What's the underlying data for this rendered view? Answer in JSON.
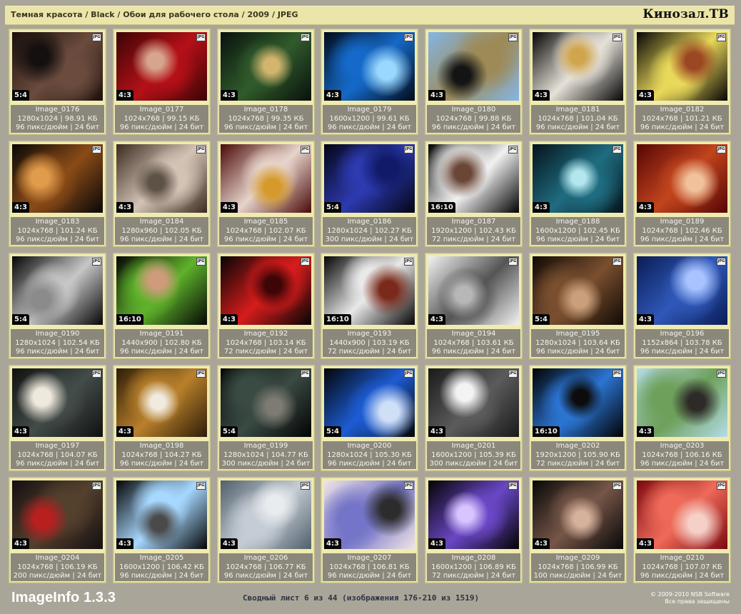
{
  "header": {
    "breadcrumb": "Темная красота / Black / Обои для рабочего стола / 2009 / JPEG",
    "brand": "Кинозал.ТВ"
  },
  "colors": {
    "background": "#a9a699",
    "card": "#f0ebb0",
    "info_panel": "#8b877a",
    "topbar": "#ebe5aa"
  },
  "thumbnails": [
    {
      "name": "Image_0176",
      "details": "1280x1024 | 98.91 КБ",
      "dpi": "96 пикс/дюйм | 24 бит",
      "ratio": "5:4",
      "colors": [
        "#1b0f0b",
        "#6b4b3d",
        "#151010"
      ],
      "icon": "jpg-file-icon"
    },
    {
      "name": "Image_0177",
      "details": "1024x768 | 99.15 КБ",
      "dpi": "96 пикс/дюйм | 24 бит",
      "ratio": "4:3",
      "colors": [
        "#3b0505",
        "#b51018",
        "#d6a58c"
      ],
      "icon": "jpg-file-icon"
    },
    {
      "name": "Image_0178",
      "details": "1024x768 | 99.35 КБ",
      "dpi": "96 пикс/дюйм | 24 бит",
      "ratio": "4:3",
      "colors": [
        "#08110c",
        "#315b2c",
        "#d3b56e"
      ],
      "icon": "jpg-file-icon"
    },
    {
      "name": "Image_0179",
      "details": "1600x1200 | 99.61 КБ",
      "dpi": "96 пикс/дюйм | 24 бит",
      "ratio": "4:3",
      "colors": [
        "#020b18",
        "#1569c8",
        "#9bd8ff"
      ],
      "icon": "jpg-file-icon"
    },
    {
      "name": "Image_0180",
      "details": "1024x768 | 99.88 КБ",
      "dpi": "96 пикс/дюйм | 24 бит",
      "ratio": "4:3",
      "colors": [
        "#84b6e7",
        "#9d8a57",
        "#141414"
      ],
      "icon": "jpg-file-icon"
    },
    {
      "name": "Image_0181",
      "details": "1024x768 | 101.04 КБ",
      "dpi": "96 пикс/дюйм | 24 бит",
      "ratio": "4:3",
      "colors": [
        "#050505",
        "#e6e1d8",
        "#d1a54d"
      ],
      "icon": "jpg-file-icon"
    },
    {
      "name": "Image_0182",
      "details": "1024x768 | 101.21 КБ",
      "dpi": "96 пикс/дюйм | 24 бит",
      "ratio": "4:3",
      "colors": [
        "#070505",
        "#e9d95a",
        "#9b4723"
      ],
      "icon": "jpg-file-icon"
    },
    {
      "name": "Image_0183",
      "details": "1024x768 | 101.24 КБ",
      "dpi": "96 пикс/дюйм | 24 бит",
      "ratio": "4:3",
      "colors": [
        "#080707",
        "#8a4b17",
        "#e09b4b"
      ],
      "icon": "jpg-file-icon"
    },
    {
      "name": "Image_0184",
      "details": "1280x960 | 102.05 КБ",
      "dpi": "96 пикс/дюйм | 24 бит",
      "ratio": "4:3",
      "colors": [
        "#3c2b20",
        "#d3c3b5",
        "#5e5146"
      ],
      "icon": "jpg-file-icon"
    },
    {
      "name": "Image_0185",
      "details": "1024x768 | 102.07 КБ",
      "dpi": "96 пикс/дюйм | 24 бит",
      "ratio": "4:3",
      "colors": [
        "#4a0a0a",
        "#e7d4ca",
        "#d59a2b"
      ],
      "icon": "jpg-file-icon"
    },
    {
      "name": "Image_0186",
      "details": "1280x1024 | 102.27 КБ",
      "dpi": "300 пикс/дюйм | 24 бит",
      "ratio": "5:4",
      "colors": [
        "#030514",
        "#2d3ab0",
        "#101a66"
      ],
      "icon": "jpg-file-icon"
    },
    {
      "name": "Image_0187",
      "details": "1920x1200 | 102.43 КБ",
      "dpi": "72 пикс/дюйм | 24 бит",
      "ratio": "16:10",
      "colors": [
        "#020202",
        "#f1f1f1",
        "#6a4636"
      ],
      "icon": "jpg-file-icon"
    },
    {
      "name": "Image_0188",
      "details": "1600x1200 | 102.45 КБ",
      "dpi": "96 пикс/дюйм | 24 бит",
      "ratio": "4:3",
      "colors": [
        "#05131b",
        "#1f6c80",
        "#b4e6ee"
      ],
      "icon": "jpg-file-icon"
    },
    {
      "name": "Image_0189",
      "details": "1024x768 | 102.46 КБ",
      "dpi": "96 пикс/дюйм | 24 бит",
      "ratio": "4:3",
      "colors": [
        "#560505",
        "#c1441d",
        "#f0c19a"
      ],
      "icon": "jpg-file-icon"
    },
    {
      "name": "Image_0190",
      "details": "1280x1024 | 102.54 КБ",
      "dpi": "96 пикс/дюйм | 24 бит",
      "ratio": "5:4",
      "colors": [
        "#050505",
        "#c7c7c7",
        "#8b8b8b"
      ],
      "icon": "jpg-file-icon"
    },
    {
      "name": "Image_0191",
      "details": "1440x900 | 102.80 КБ",
      "dpi": "96 пикс/дюйм | 24 бит",
      "ratio": "16:10",
      "colors": [
        "#050604",
        "#5fb22b",
        "#d09b7c"
      ],
      "icon": "jpg-file-icon"
    },
    {
      "name": "Image_0192",
      "details": "1024x768 | 103.14 КБ",
      "dpi": "72 пикс/дюйм | 24 бит",
      "ratio": "4:3",
      "colors": [
        "#050505",
        "#d71c1c",
        "#3c0606"
      ],
      "icon": "jpg-file-icon"
    },
    {
      "name": "Image_0193",
      "details": "1440x900 | 103.19 КБ",
      "dpi": "72 пикс/дюйм | 24 бит",
      "ratio": "16:10",
      "colors": [
        "#050505",
        "#e9e9e9",
        "#7a2a1b"
      ],
      "icon": "jpg-file-icon"
    },
    {
      "name": "Image_0194",
      "details": "1024x768 | 103.61 КБ",
      "dpi": "96 пикс/дюйм | 24 бит",
      "ratio": "4:3",
      "colors": [
        "#f2f2f2",
        "#555",
        "#b7b7b7"
      ],
      "icon": "jpg-file-icon"
    },
    {
      "name": "Image_0195",
      "details": "1280x1024 | 103.64 КБ",
      "dpi": "96 пикс/дюйм | 24 бит",
      "ratio": "5:4",
      "colors": [
        "#100905",
        "#7a4f2f",
        "#caa07c"
      ],
      "icon": "jpg-file-icon"
    },
    {
      "name": "Image_0196",
      "details": "1152x864 | 103.78 КБ",
      "dpi": "96 пикс/дюйм | 24 бит",
      "ratio": "4:3",
      "colors": [
        "#0a1c54",
        "#2f58b9",
        "#a8c3ff"
      ],
      "icon": "jpg-file-icon"
    },
    {
      "name": "Image_0197",
      "details": "1024x768 | 104.07 КБ",
      "dpi": "96 пикс/дюйм | 24 бит",
      "ratio": "4:3",
      "colors": [
        "#101111",
        "#434c49",
        "#efe8dc"
      ],
      "icon": "jpg-file-icon"
    },
    {
      "name": "Image_0198",
      "details": "1024x768 | 104.27 КБ",
      "dpi": "96 пикс/дюйм | 24 бит",
      "ratio": "4:3",
      "colors": [
        "#2d1d08",
        "#b9802b",
        "#f0eadf"
      ],
      "icon": "jpg-file-icon"
    },
    {
      "name": "Image_0199",
      "details": "1280x1024 | 104.77 КБ",
      "dpi": "300 пикс/дюйм | 24 бит",
      "ratio": "5:4",
      "colors": [
        "#030303",
        "#3a4b44",
        "#7d7b72"
      ],
      "icon": "jpg-file-icon"
    },
    {
      "name": "Image_0200",
      "details": "1280x1024 | 105.30 КБ",
      "dpi": "96 пикс/дюйм | 24 бит",
      "ratio": "5:4",
      "colors": [
        "#030507",
        "#1d5cd4",
        "#cfdff6"
      ],
      "icon": "jpg-file-icon"
    },
    {
      "name": "Image_0201",
      "details": "1600x1200 | 105.39 КБ",
      "dpi": "300 пикс/дюйм | 24 бит",
      "ratio": "4:3",
      "colors": [
        "#1a1a1a",
        "#5b5b5b",
        "#f3f3f3"
      ],
      "icon": "jpg-file-icon"
    },
    {
      "name": "Image_0202",
      "details": "1920x1200 | 105.90 КБ",
      "dpi": "72 пикс/дюйм | 24 бит",
      "ratio": "16:10",
      "colors": [
        "#020202",
        "#2b75d3",
        "#0c0c0c"
      ],
      "icon": "jpg-file-icon"
    },
    {
      "name": "Image_0203",
      "details": "1024x768 | 106.16 КБ",
      "dpi": "96 пикс/дюйм | 24 бит",
      "ratio": "4:3",
      "colors": [
        "#b4dce8",
        "#6ea05b",
        "#2e2a27"
      ],
      "icon": "jpg-file-icon"
    },
    {
      "name": "Image_0204",
      "details": "1024x768 | 106.19 КБ",
      "dpi": "200 пикс/дюйм | 24 бит",
      "ratio": "4:3",
      "colors": [
        "#150f11",
        "#53402d",
        "#b91f1f"
      ],
      "icon": "jpg-file-icon"
    },
    {
      "name": "Image_0205",
      "details": "1600x1200 | 106.42 КБ",
      "dpi": "96 пикс/дюйм | 24 бит",
      "ratio": "4:3",
      "colors": [
        "#050505",
        "#a7d8ff",
        "#4a4a4a"
      ],
      "icon": "jpg-file-icon"
    },
    {
      "name": "Image_0206",
      "details": "1024x768 | 106.77 КБ",
      "dpi": "96 пикс/дюйм | 24 бит",
      "ratio": "4:3",
      "colors": [
        "#51606c",
        "#c5ccd4",
        "#e9ecef"
      ],
      "icon": "jpg-file-icon"
    },
    {
      "name": "Image_0207",
      "details": "1024x768 | 106.81 КБ",
      "dpi": "96 пикс/дюйм | 24 бит",
      "ratio": "4:3",
      "colors": [
        "#f0e5e6",
        "#7474c8",
        "#2c2c2c"
      ],
      "icon": "jpg-file-icon"
    },
    {
      "name": "Image_0208",
      "details": "1600x1200 | 106.89 КБ",
      "dpi": "72 пикс/дюйм | 24 бит",
      "ratio": "4:3",
      "colors": [
        "#030303",
        "#6a47c6",
        "#d7c5ff"
      ],
      "icon": "jpg-file-icon"
    },
    {
      "name": "Image_0209",
      "details": "1024x768 | 106.99 КБ",
      "dpi": "100 пикс/дюйм | 24 бит",
      "ratio": "4:3",
      "colors": [
        "#070707",
        "#765648",
        "#d4b29c"
      ],
      "icon": "jpg-file-icon"
    },
    {
      "name": "Image_0210",
      "details": "1024x768 | 107.07 КБ",
      "dpi": "96 пикс/дюйм | 24 бит",
      "ratio": "4:3",
      "colors": [
        "#7b0810",
        "#ef6a59",
        "#f5d0c8"
      ],
      "icon": "jpg-file-icon"
    }
  ],
  "footer": {
    "app_name": "ImageInfo 1.3.3",
    "summary": "Сводный лист 6 из 44 (изображения 176-210 из 1519)",
    "copyright_1": "© 2009-2010 NSB Software",
    "copyright_2": "Все права защищены"
  }
}
